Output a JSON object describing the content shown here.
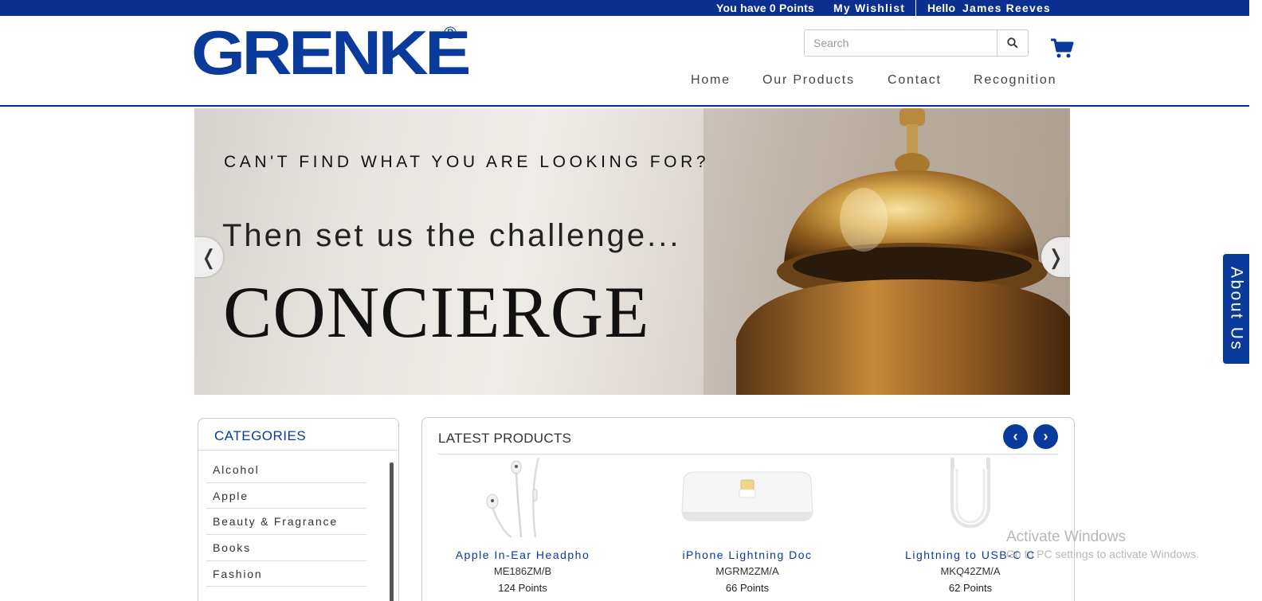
{
  "topbar": {
    "points": "You have 0 Points",
    "wishlist": "My Wishlist",
    "hello": "Hello",
    "user": "James Reeves"
  },
  "header": {
    "logo": "GRENKE",
    "logo_mark": "®",
    "search_placeholder": "Search",
    "nav": [
      "Home",
      "Our Products",
      "Contact",
      "Recognition"
    ]
  },
  "banner": {
    "line1": "CAN'T FIND WHAT YOU ARE LOOKING FOR?",
    "line2": "Then set us the challenge...",
    "line3": "CONCIERGE",
    "prev": "❬",
    "next": "❭"
  },
  "about_tab": "About Us",
  "categories": {
    "title": "CATEGORIES",
    "items": [
      "Alcohol",
      "Apple",
      "Beauty & Fragrance",
      "Books",
      "Fashion"
    ]
  },
  "latest_products": {
    "title": "LATEST PRODUCTS",
    "prev": "‹",
    "next": "›",
    "items": [
      {
        "name": "Apple In-Ear Headpho",
        "code": "ME186ZM/B",
        "points": "124 Points",
        "icon": "earphones-icon"
      },
      {
        "name": "iPhone Lightning Doc",
        "code": "MGRM2ZM/A",
        "points": "66 Points",
        "icon": "dock-icon"
      },
      {
        "name": "Lightning to USB-C C",
        "code": "MKQ42ZM/A",
        "points": "62 Points",
        "icon": "cable-icon"
      }
    ]
  },
  "watermark": {
    "line1": "Activate Windows",
    "line2": "Go to PC settings to activate Windows."
  },
  "colors": {
    "brand": "#0a3a9c",
    "topbar": "#0a2f8e"
  }
}
